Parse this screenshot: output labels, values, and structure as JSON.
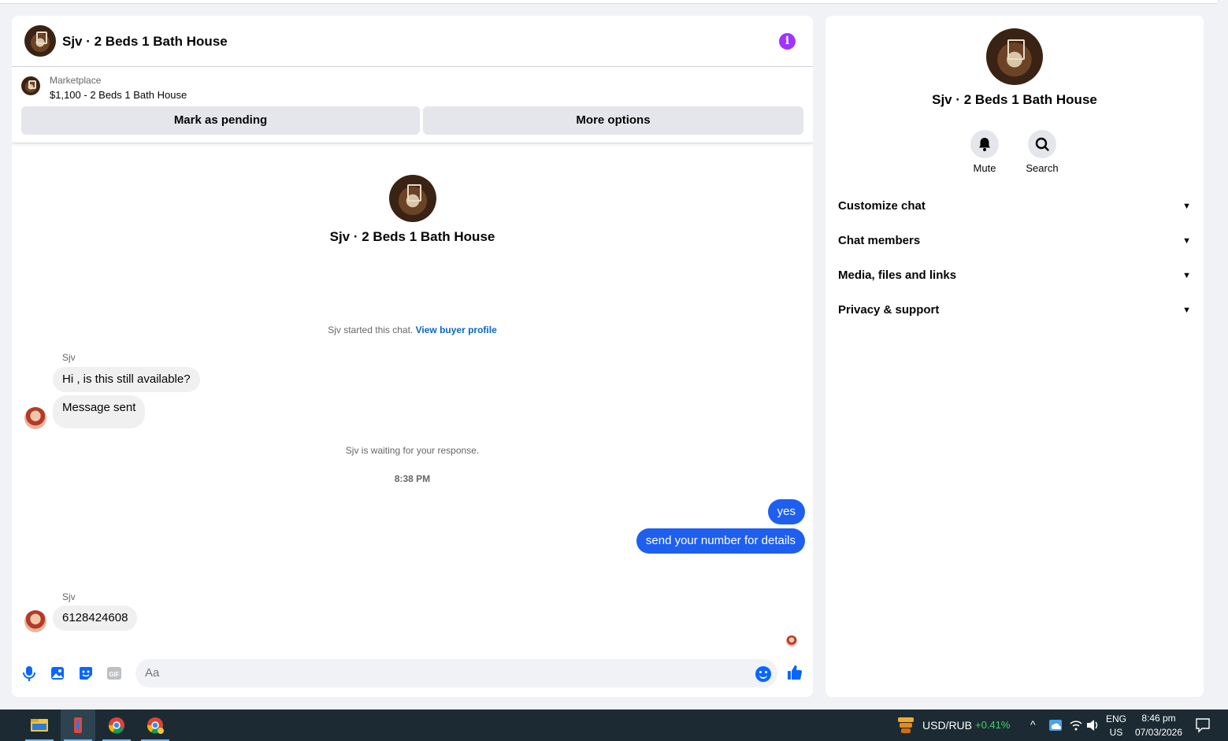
{
  "conversation": {
    "title": "Sjv · 2 Beds 1 Bath House"
  },
  "listing": {
    "source_label": "Marketplace",
    "item": "$1,100 - 2 Beds 1 Bath House",
    "mark_pending_label": "Mark as pending",
    "more_options_label": "More options"
  },
  "thread": {
    "name": "Sjv · 2 Beds 1 Bath House",
    "started_text": "Sjv started this chat.",
    "buyer_profile_link": "View buyer profile",
    "messages_1": {
      "sender": "Sjv",
      "msg1": "Hi , is this still available?",
      "msg2": "Message sent"
    },
    "waiting_text": "Sjv is waiting for your response.",
    "timestamp": "8:38 PM",
    "outgoing": {
      "msg1": "yes",
      "msg2": "send your number for details"
    },
    "messages_2": {
      "sender": "Sjv",
      "msg1": "6128424608"
    }
  },
  "composer": {
    "placeholder": "Aa",
    "icons": [
      "microphone-icon",
      "photo-icon",
      "sticker-icon",
      "gif-icon",
      "emoji-icon",
      "thumbs-up-icon"
    ],
    "gif_label": "GIF"
  },
  "side_panel": {
    "name": "Sjv · 2 Beds 1 Bath House",
    "mute_label": "Mute",
    "search_label": "Search",
    "sections": [
      "Customize chat",
      "Chat members",
      "Media, files and links",
      "Privacy & support"
    ]
  },
  "taskbar": {
    "ticker": "USD/RUB",
    "ticker_change": "+0.41%",
    "lang_1": "ENG",
    "lang_2": "US",
    "time": "8:46 pm",
    "date": "07/03/2026"
  },
  "colors": {
    "accent": "#0866ff",
    "info": "#a033ff",
    "outgoing_bubble": "#1e5ff0",
    "ticker_positive": "#3fd36b",
    "taskbar": "#1c2b33"
  }
}
